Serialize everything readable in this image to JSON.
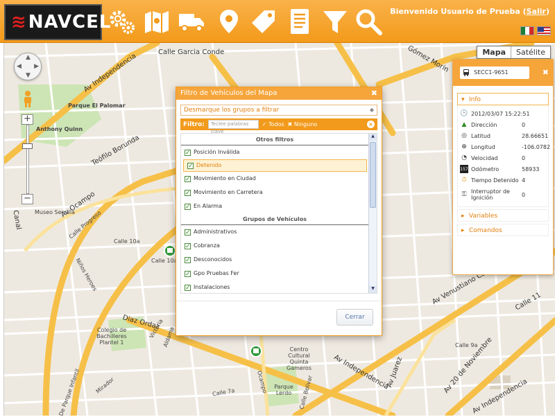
{
  "header": {
    "logo_text": "NAVCEL",
    "welcome_text": "Bienvenido Usuario de Prueba (",
    "logout_link": "Salir",
    "welcome_close": ")",
    "toolbar_icons": [
      "gears-icon",
      "map-route-icon",
      "truck-icon",
      "map-pin-icon",
      "tag-icon",
      "report-icon",
      "filter-icon",
      "search-icon"
    ]
  },
  "map": {
    "type_buttons": [
      "Mapa",
      "Satélite"
    ],
    "street_labels": [
      "Calle Garcia Conde",
      "Av Independencia",
      "Parque El Palomar",
      "Anthony Quinn",
      "Teófilo Borunda",
      "Av Ocampo",
      "Calle Progreso",
      "Museo Semilla",
      "Canal",
      "Niños Heroes",
      "Diaz Ordaz",
      "Victoria",
      "Aldama",
      "Colegio de Bachilleres Plantel 1",
      "Centro Cultural Quinta Gameros",
      "Parque Lerdo",
      "Av Independencia",
      "Av Venustiano Carranza",
      "Calle 11",
      "Gómez Morin",
      "Av Juarez",
      "Av 20 de Noviembre",
      "Av Independencia",
      "Ocampo",
      "Calle Bolivar",
      "De Parque Infantil",
      "Mirador",
      "Calle 7a",
      "Calle 10a",
      "Calle 10a",
      "Calle 9a"
    ]
  },
  "dialog": {
    "title": "Filtro de Vehículos del Mapa",
    "group_select": "Desmarque los grupos a filtrar",
    "filter_label": "Filtro:",
    "filter_placeholder": "Teclee palabras clave",
    "all_label": "Todos",
    "none_label": "Ninguno",
    "other_filters_header": "Otros filtros",
    "other_filters": [
      "Posición Inválida",
      "Detenido",
      "Movimiento en Ciudad",
      "Movimiento en Carretera",
      "En Alarma"
    ],
    "groups_header": "Grupos de Vehículos",
    "groups": [
      "Administrativos",
      "Cobranza",
      "Desconocidos",
      "Gpo Pruebas Fer",
      "Instalaciones"
    ],
    "close_button": "Cerrar"
  },
  "panel": {
    "vehicle_name": "SECC1-9651",
    "info_label": "Info",
    "variables_label": "Variables",
    "commands_label": "Comandos",
    "datetime": "2012/03/07 15:22:51",
    "fields": [
      {
        "label": "Dirección",
        "value": "0"
      },
      {
        "label": "Latitud",
        "value": "28.66651"
      },
      {
        "label": "Longitud",
        "value": "-106.0782"
      },
      {
        "label": "Velocidad",
        "value": "0"
      },
      {
        "label": "Odómetro",
        "value": "58933"
      },
      {
        "label": "Tiempo Detenido",
        "value": "4"
      },
      {
        "label": "Interruptor de Ignición",
        "value": "0"
      }
    ],
    "odometer_badge": "157"
  },
  "colors": {
    "accent": "#f29a1c",
    "highlight_bg": "#fdf2d4",
    "accent_text": "#e37f0c"
  }
}
